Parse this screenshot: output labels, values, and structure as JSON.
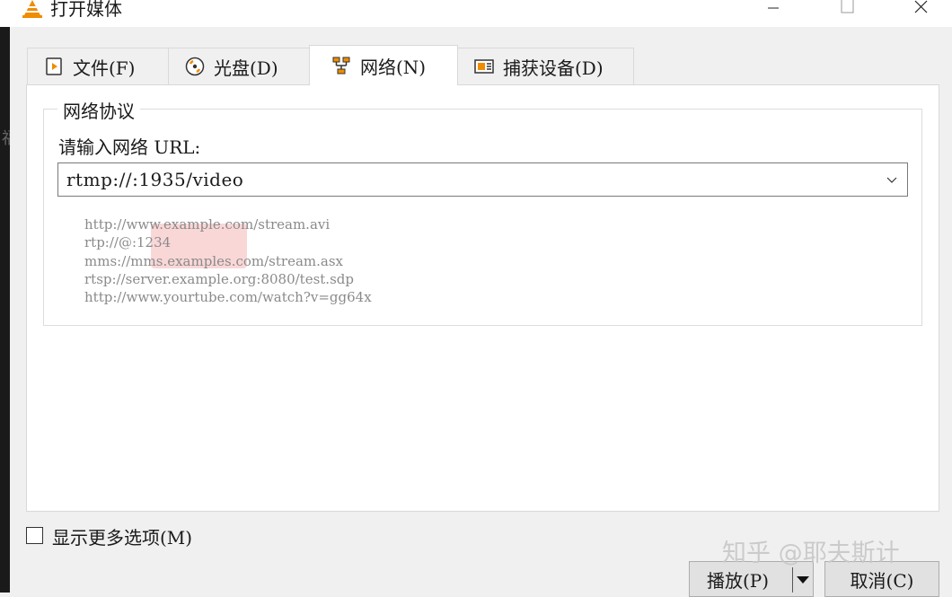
{
  "window": {
    "title": "打开媒体"
  },
  "tabs": [
    {
      "label": "文件(F)",
      "icon": "file-play-icon"
    },
    {
      "label": "光盘(D)",
      "icon": "disc-icon"
    },
    {
      "label": "网络(N)",
      "icon": "network-icon",
      "active": true
    },
    {
      "label": "捕获设备(D)",
      "icon": "capture-device-icon"
    }
  ],
  "network": {
    "group_title": "网络协议",
    "prompt": "请输入网络 URL:",
    "url_value": "rtmp://:1935/video",
    "examples": [
      "http://www.example.com/stream.avi",
      "rtp://@:1234",
      "mms://mms.examples.com/stream.asx",
      "rtsp://server.example.org:8080/test.sdp",
      "http://www.yourtube.com/watch?v=gg64x"
    ]
  },
  "options": {
    "show_more_label": "显示更多选项(M)"
  },
  "buttons": {
    "play": "播放(P)",
    "cancel": "取消(C)"
  },
  "watermark": "知乎 @耶夫斯计",
  "background_glyph": "福",
  "colors": {
    "vlc_orange": "#f08c00",
    "panel_bg": "#ffffff",
    "window_bg": "#f0f0f0",
    "example_text": "#8a8a8a"
  }
}
